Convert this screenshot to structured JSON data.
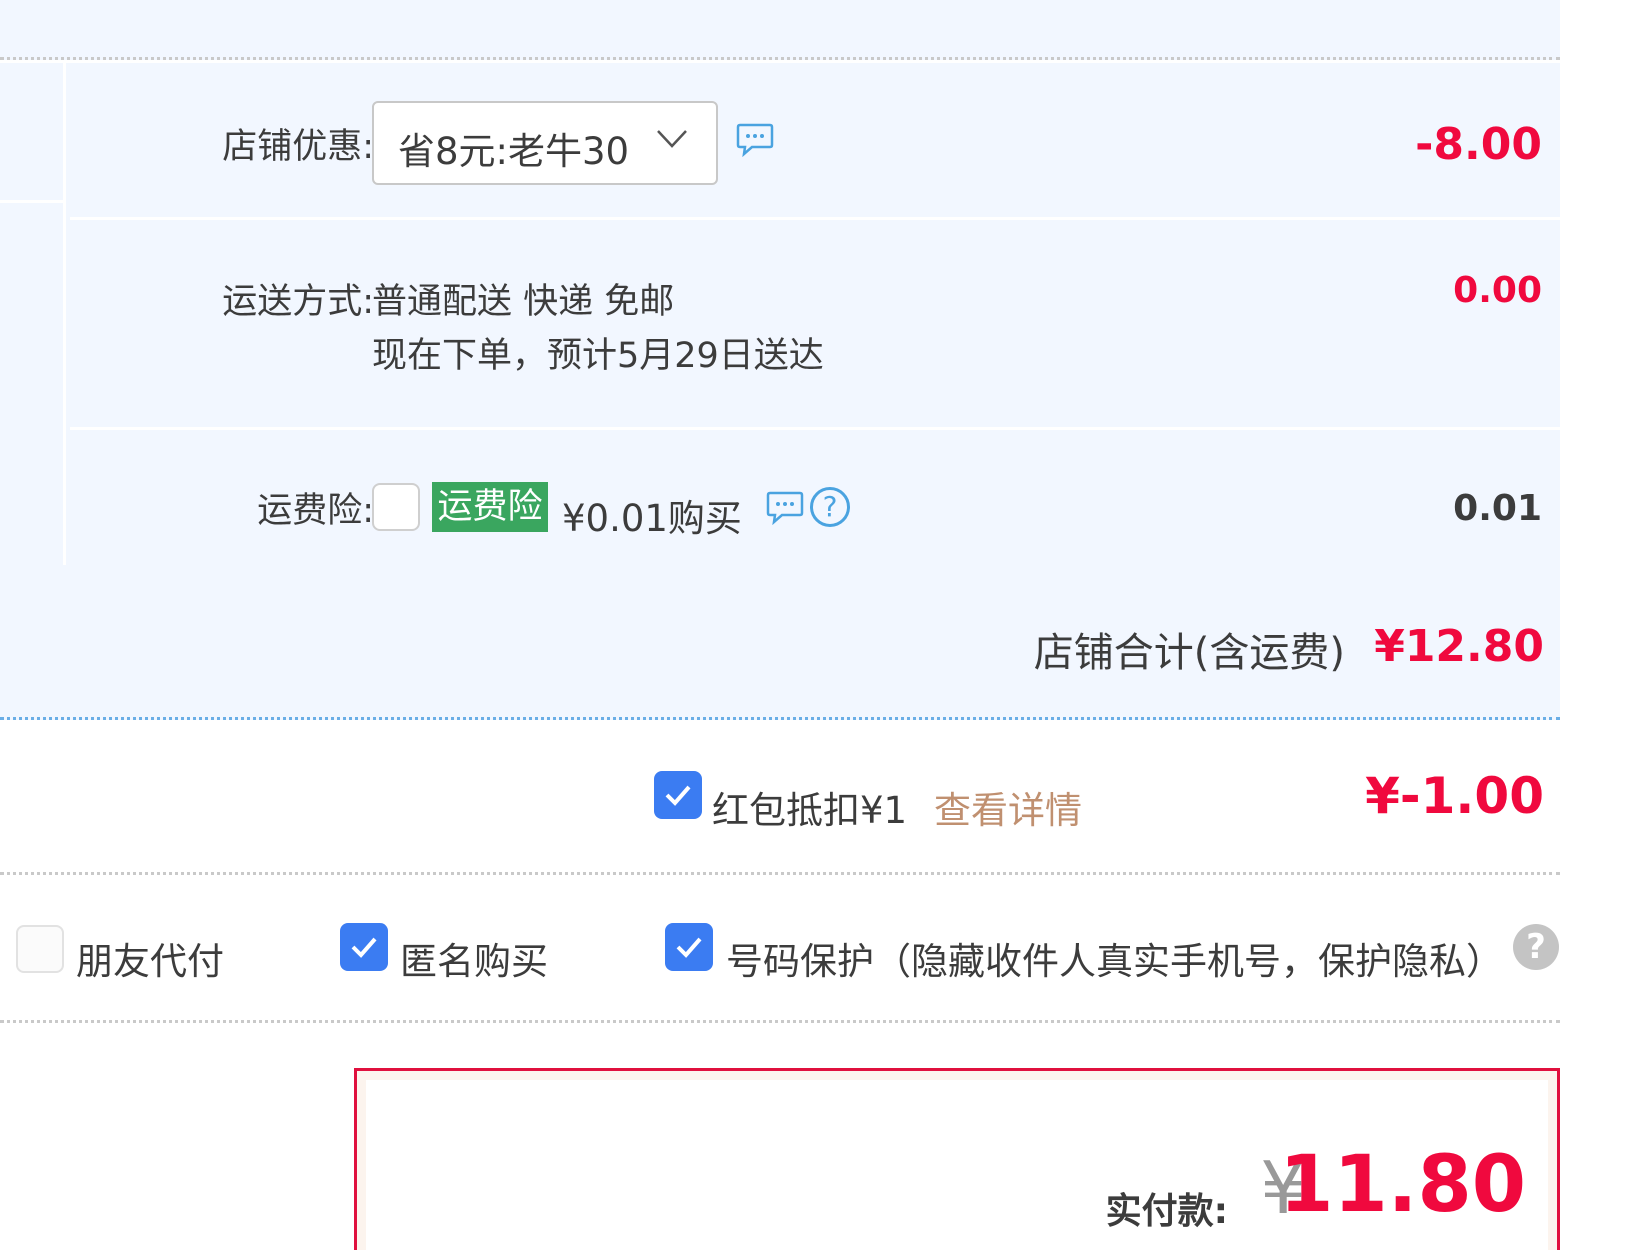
{
  "shop_discount": {
    "label": "店铺优惠:",
    "selected_option": "省8元:老牛30",
    "amount": "-8.00",
    "icons": [
      "chevron-down-icon",
      "message-icon"
    ]
  },
  "shipping": {
    "label": "运送方式:",
    "method": "普通配送 快递 免邮",
    "estimate": "现在下单，预计5月29日送达",
    "amount": "0.00"
  },
  "shipping_insurance": {
    "label": "运费险:",
    "checked": false,
    "badge": "运费险",
    "price_text": "¥0.01购买",
    "amount": "0.01",
    "icons": [
      "message-icon",
      "question-icon"
    ]
  },
  "shop_total": {
    "label": "店铺合计(含运费)",
    "amount": "¥12.80"
  },
  "red_packet": {
    "checked": true,
    "label": "红包抵扣¥1",
    "detail_link": "查看详情",
    "amount": "¥-1.00"
  },
  "options": {
    "friend_pay": {
      "label": "朋友代付",
      "checked": false
    },
    "anonymous": {
      "label": "匿名购买",
      "checked": true
    },
    "number_protection": {
      "label": "号码保护（隐藏收件人真实手机号，保护隐私）",
      "checked": true
    }
  },
  "payment": {
    "label": "实付款:",
    "currency": "¥",
    "amount": "11.80"
  },
  "colors": {
    "accent_red": "#f0093e",
    "check_blue": "#3b7cf2",
    "insurance_green": "#3aa65f",
    "panel_bg": "#f2f7ff",
    "link_tan": "#c09070"
  }
}
